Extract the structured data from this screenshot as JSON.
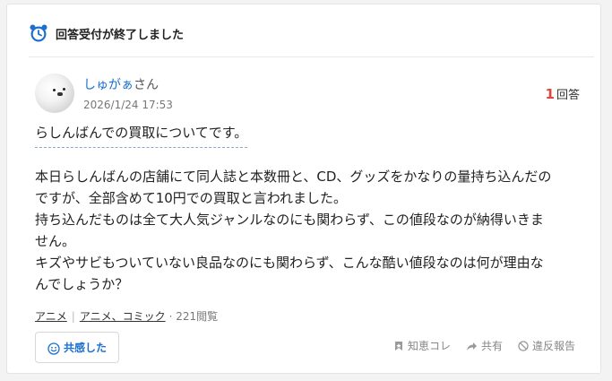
{
  "status": {
    "text": "回答受付が終了しました",
    "icon": "alarm-clock-icon"
  },
  "user": {
    "name": "しゅがぁ",
    "suffix": "さん",
    "date": "2026/1/24 17:53"
  },
  "answers": {
    "count": "1",
    "label": "回答"
  },
  "question": {
    "title": "らしんばんでの買取についてです。",
    "body": [
      "本日らしんばんの店舗にて同人誌と本数冊と、CD、グッズをかなりの量持ち込んだの",
      "ですが、全部含めて10円での買取と言われました。",
      "持ち込んだものは全て大人気ジャンルなのにも関わらず、この値段なのが納得いきま",
      "せん。",
      "キズやサビもついていない良品なのにも関わらず、こんな酷い値段なのは何が理由な",
      "んでしょうか？"
    ]
  },
  "categories": {
    "items": [
      "アニメ",
      "アニメ、コミック"
    ],
    "views": "221閲覧"
  },
  "buttons": {
    "empathy": "共感した"
  },
  "actions": {
    "knowledge": "知恵コレ",
    "share": "共有",
    "report": "違反報告"
  },
  "colors": {
    "accent_blue": "#1a6fcf",
    "answer_count_red": "#e2453c"
  }
}
